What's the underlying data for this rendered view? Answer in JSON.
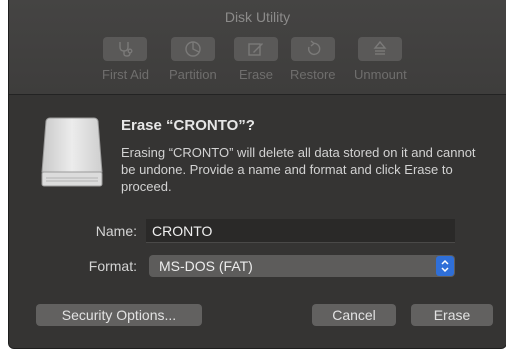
{
  "window": {
    "title": "Disk Utility"
  },
  "toolbar": {
    "items": [
      {
        "label": "First Aid",
        "icon": "stethoscope-icon"
      },
      {
        "label": "Partition",
        "icon": "pie-chart-icon"
      },
      {
        "label": "Erase",
        "icon": "eraser-icon"
      },
      {
        "label": "Restore",
        "icon": "restore-arrow-icon"
      },
      {
        "label": "Unmount",
        "icon": "eject-icon"
      }
    ]
  },
  "dialog": {
    "icon": "external-drive-icon",
    "heading": "Erase “CRONTO”?",
    "message": "Erasing “CRONTO” will delete all data stored on it and cannot be undone. Provide a name and format and click Erase to proceed.",
    "name_label": "Name:",
    "name_value": "CRONTO",
    "format_label": "Format:",
    "format_value": "MS-DOS (FAT)",
    "security_options_label": "Security Options...",
    "cancel_label": "Cancel",
    "erase_label": "Erase"
  },
  "colors": {
    "window_bg": "#3b3a39",
    "dialog_bg": "#353433",
    "accent": "#2f6fd8",
    "button_bg": "#626160"
  }
}
